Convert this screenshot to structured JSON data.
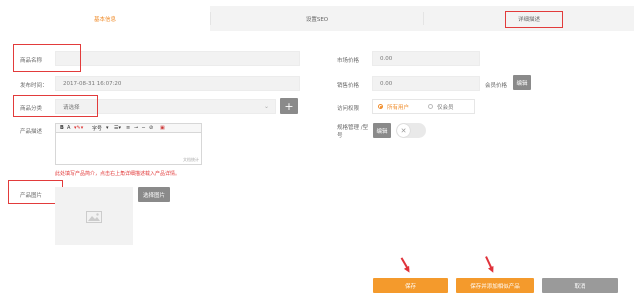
{
  "tabs": [
    {
      "label": "基本信息"
    },
    {
      "label": "设置SEO"
    },
    {
      "label": "详细描述"
    }
  ],
  "form": {
    "name_label": "商品名称",
    "name_value": "",
    "publish_time_label": "发布时间：",
    "publish_time_value": "2017-08-31 16:07:20",
    "category_label": "商品分类",
    "category_value": "请选择",
    "description_label": "产品描述",
    "editor_font": "字号",
    "editor_word_count": "文档统计",
    "description_hint": "此处填写产品简介，点击右上角详细描述载入产品详情。",
    "image_label": "产品图片",
    "select_image_button": "选择图片"
  },
  "right_form": {
    "market_price_label": "市场价格",
    "market_price_value": "0.00",
    "sale_price_label": "销售价格",
    "sale_price_value": "0.00",
    "member_price_label": "会员价格",
    "edit_button": "编辑",
    "access_label": "访问权限",
    "access_options": [
      "所有用户",
      "仅会员"
    ],
    "spec_label": "规格管理 /型号",
    "spec_edit_button": "编辑"
  },
  "footer": {
    "save": "保存",
    "save_and_add": "保存并添加相似产品",
    "cancel": "取消"
  },
  "colors": {
    "accent": "#f49a2c",
    "annotation": "#e23b3b"
  }
}
